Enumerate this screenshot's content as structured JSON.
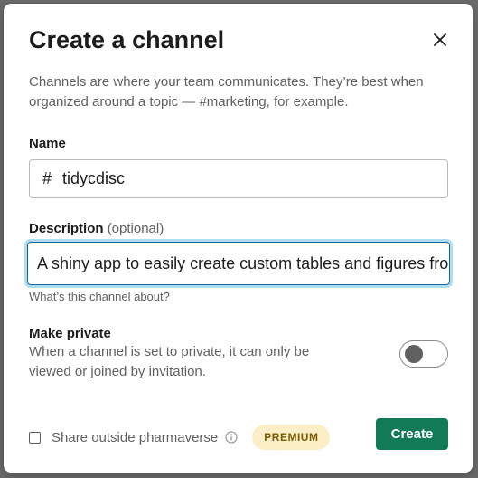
{
  "dialog": {
    "title": "Create a channel",
    "intro": "Channels are where your team communicates. They’re best when organized around a topic — #marketing, for example."
  },
  "name": {
    "label": "Name",
    "prefix": "#",
    "value": "tidycdisc"
  },
  "description": {
    "label": "Description",
    "optional": "(optional)",
    "value": "A shiny app to easily create custom tables and figures from ADaM-ish data",
    "hint": "What’s this channel about?"
  },
  "private": {
    "label": "Make private",
    "description": "When a channel is set to private, it can only be viewed or joined by invitation.",
    "enabled": false
  },
  "share": {
    "label": "Share outside pharmaverse",
    "badge": "PREMIUM",
    "checked": false
  },
  "actions": {
    "create_label": "Create"
  },
  "colors": {
    "primary_button": "#127a57",
    "focus_ring": "#1264a3",
    "premium_bg": "#fcefc7"
  },
  "icons": {
    "close": "close-icon",
    "info": "info-icon"
  }
}
